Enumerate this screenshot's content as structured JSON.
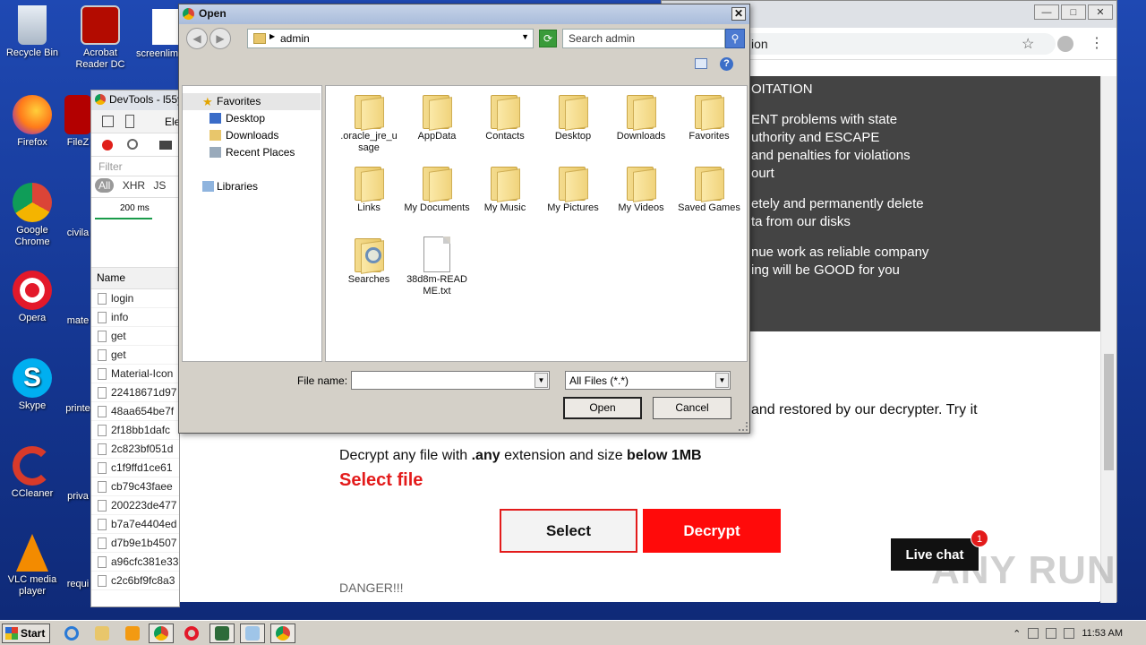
{
  "desktop": {
    "icons": [
      {
        "label": "Recycle Bin"
      },
      {
        "label": "Acrobat Reader DC"
      },
      {
        "label": "screenlim"
      },
      {
        "label": "Firefox"
      },
      {
        "label": "FileZ"
      },
      {
        "label": "Google Chrome"
      },
      {
        "label": "civila"
      },
      {
        "label": "Opera"
      },
      {
        "label": "mate"
      },
      {
        "label": "Skype"
      },
      {
        "label": "printe"
      },
      {
        "label": "CCleaner"
      },
      {
        "label": "priva"
      },
      {
        "label": "VLC media player"
      },
      {
        "label": "requi"
      }
    ]
  },
  "devtools": {
    "title": "DevTools - l55y",
    "tab_partial": "Ele",
    "filter_placeholder": "Filter",
    "types": {
      "all": "All",
      "xhr": "XHR",
      "js": "JS"
    },
    "timeline_label": "200 ms",
    "name_header": "Name",
    "requests": [
      "login",
      "info",
      "get",
      "get",
      "Material-Icon",
      "22418671d97",
      "48aa654be7f",
      "2f18bb1dafc",
      "2c823bf051d",
      "c1f9ffd1ce61",
      "cb79c43faee",
      "200223de477",
      "b7a7e4404ed",
      "d7b9e1b4507",
      "a96cfc381e33",
      "c2c6bf9fc8a3"
    ]
  },
  "chrome": {
    "omnibox_text": "ion",
    "dark_lines": [
      "OITATION",
      "ENT problems with state",
      "uthority and ESCAPE",
      " and penalties for violations",
      "ourt",
      "etely and permanently delete",
      "ta from our disks",
      "nue work as reliable company",
      "ing will be GOOD for you"
    ],
    "restored_text": "and restored by our decrypter. Try it",
    "decrypt_prefix": "Decrypt any file with ",
    "decrypt_ext": ".any",
    "decrypt_mid": " extension and size ",
    "decrypt_size": "below 1MB",
    "select_file": "Select file",
    "select_button": "Select",
    "decrypt_button": "Decrypt",
    "danger": "DANGER!!!",
    "live_chat": "Live chat",
    "live_chat_badge": "1",
    "watermark": "ANY RUN"
  },
  "dialog": {
    "title": "Open",
    "address": "admin",
    "search_placeholder": "Search admin",
    "nav": {
      "favorites": "Favorites",
      "desktop": "Desktop",
      "downloads": "Downloads",
      "recent_places": "Recent Places",
      "libraries": "Libraries"
    },
    "files": [
      {
        "name": ".oracle_jre_u sage",
        "kind": "folder"
      },
      {
        "name": "AppData",
        "kind": "folder"
      },
      {
        "name": "Contacts",
        "kind": "folder"
      },
      {
        "name": "Desktop",
        "kind": "folder"
      },
      {
        "name": "Downloads",
        "kind": "folder"
      },
      {
        "name": "Favorites",
        "kind": "folder"
      },
      {
        "name": "Links",
        "kind": "folder"
      },
      {
        "name": "My Documents",
        "kind": "folder"
      },
      {
        "name": "My Music",
        "kind": "folder"
      },
      {
        "name": "My Pictures",
        "kind": "folder"
      },
      {
        "name": "My Videos",
        "kind": "folder"
      },
      {
        "name": "Saved Games",
        "kind": "folder"
      },
      {
        "name": "Searches",
        "kind": "search-folder"
      },
      {
        "name": "38d8m-READ ME.txt",
        "kind": "text-file"
      }
    ],
    "file_name_label": "File name:",
    "file_name_value": "",
    "file_type": "All Files (*.*)",
    "open_button": "Open",
    "cancel_button": "Cancel"
  },
  "taskbar": {
    "start": "Start",
    "clock": "11:53 AM"
  },
  "colors": {
    "accent_red": "#e31b1b",
    "desktop_blue": "#1a3d9e"
  }
}
